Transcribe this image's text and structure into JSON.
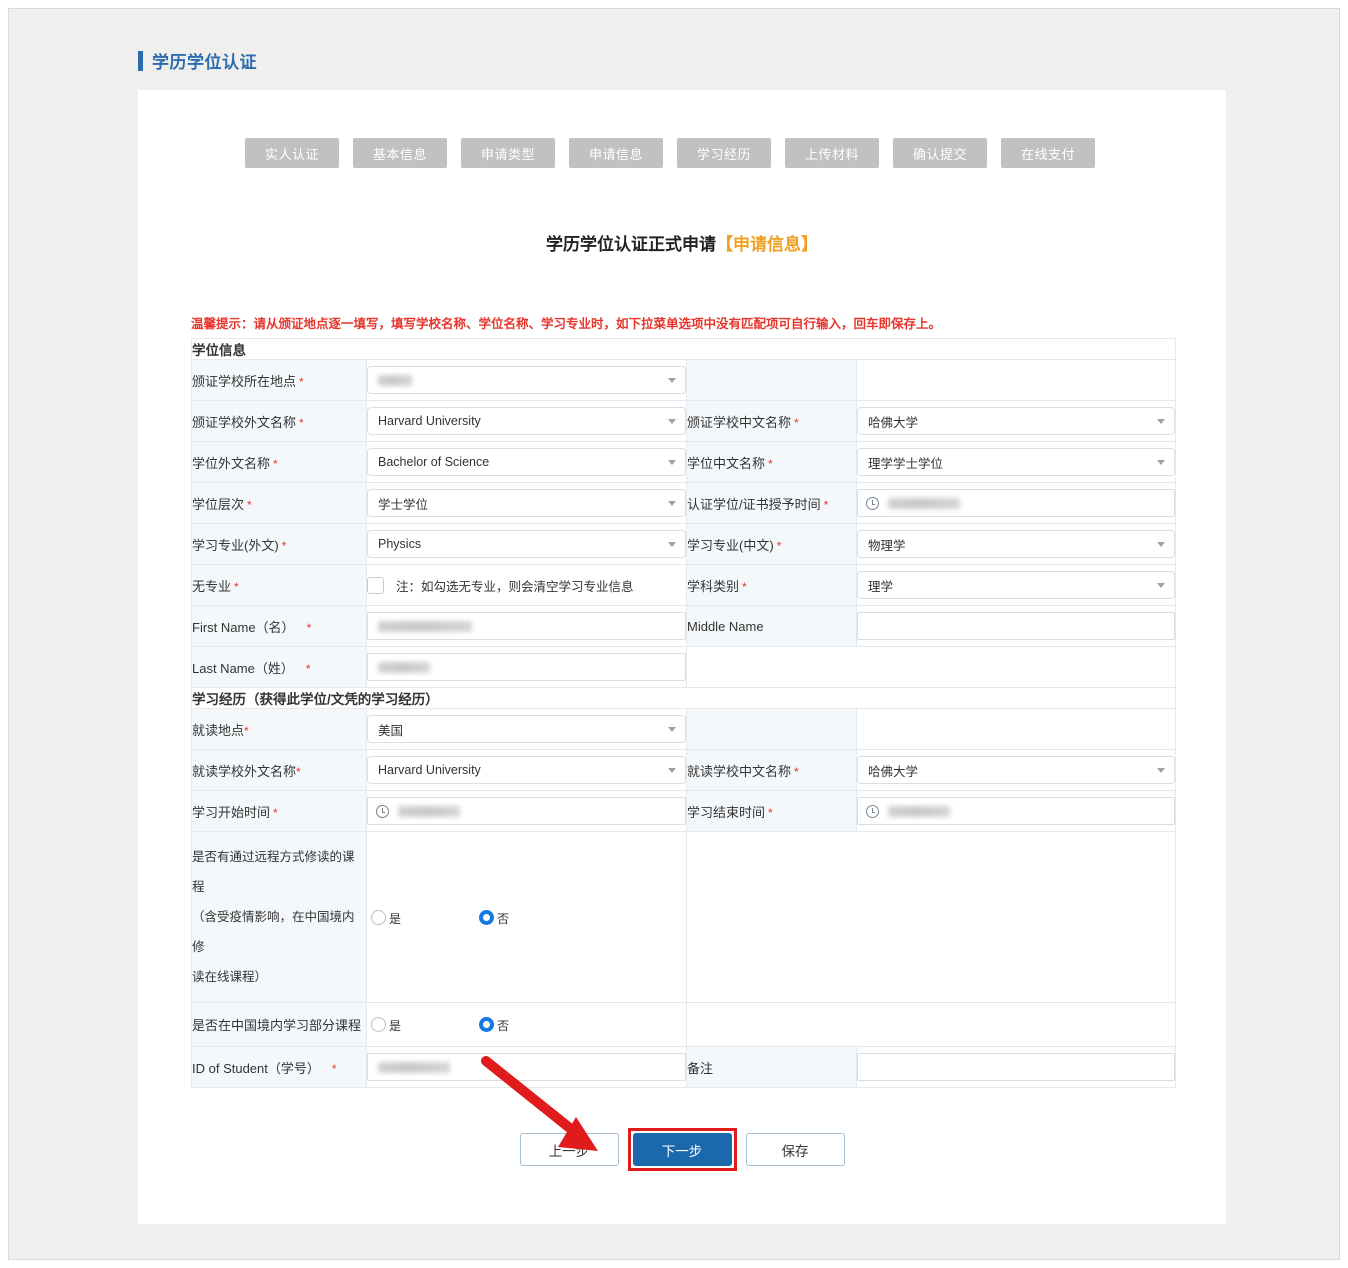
{
  "header": {
    "title": "学历学位认证"
  },
  "steps": [
    {
      "label": "实人认证"
    },
    {
      "label": "基本信息"
    },
    {
      "label": "申请类型"
    },
    {
      "label": "申请信息"
    },
    {
      "label": "学习经历"
    },
    {
      "label": "上传材料"
    },
    {
      "label": "确认提交"
    },
    {
      "label": "在线支付"
    }
  ],
  "form": {
    "title_main": "学历学位认证正式申请",
    "title_highlight": "【申请信息】",
    "notice": "温馨提示：请从颁证地点逐一填写，填写学校名称、学位名称、学习专业时，如下拉菜单选项中没有匹配项可自行输入，回车即保存上。"
  },
  "degree_section": {
    "heading": "学位信息",
    "rows": {
      "issue_location_label": "颁证学校所在地点",
      "issue_location_value": "",
      "school_foreign_label": "颁证学校外文名称",
      "school_foreign_value": "Harvard University",
      "school_chinese_label": "颁证学校中文名称",
      "school_chinese_value": "哈佛大学",
      "degree_foreign_label": "学位外文名称",
      "degree_foreign_value": "Bachelor of Science",
      "degree_chinese_label": "学位中文名称",
      "degree_chinese_value": "理学学士学位",
      "degree_level_label": "学位层次",
      "degree_level_value": "学士学位",
      "award_date_label": "认证学位/证书授予时间",
      "award_date_value": "",
      "major_foreign_label": "学习专业(外文)",
      "major_foreign_value": "Physics",
      "major_chinese_label": "学习专业(中文)",
      "major_chinese_value": "物理学",
      "no_major_label": "无专业",
      "no_major_note": "注：如勾选无专业，则会清空学习专业信息",
      "no_major_checked": false,
      "subject_category_label": "学科类别",
      "subject_category_value": "理学",
      "first_name_label": "First Name（名）",
      "first_name_value": "",
      "middle_name_label": "Middle Name",
      "middle_name_value": "",
      "last_name_label": "Last Name（姓）",
      "last_name_value": ""
    }
  },
  "study_section": {
    "heading": "学习经历（获得此学位/文凭的学习经历）",
    "rows": {
      "study_location_label": "就读地点",
      "study_location_value": "美国",
      "study_school_foreign_label": "就读学校外文名称",
      "study_school_foreign_value": "Harvard University",
      "study_school_chinese_label": "就读学校中文名称",
      "study_school_chinese_value": "哈佛大学",
      "start_date_label": "学习开始时间",
      "start_date_value": "",
      "end_date_label": "学习结束时间",
      "end_date_value": "",
      "remote_label_line1": "是否有通过远程方式修读的课程",
      "remote_label_line2": "（含受疫情影响，在中国境内修",
      "remote_label_line3": "读在线课程）",
      "remote_yes": "是",
      "remote_no": "否",
      "remote_selected": "否",
      "domestic_label": "是否在中国境内学习部分课程",
      "domestic_yes": "是",
      "domestic_no": "否",
      "domestic_selected": "否",
      "student_id_label": "ID of Student（学号）",
      "student_id_value": "",
      "remark_label": "备注",
      "remark_value": ""
    }
  },
  "buttons": {
    "prev": "上一步",
    "next": "下一步",
    "save": "保存"
  },
  "colors": {
    "accent_blue": "#2c6cad",
    "primary_button": "#1b68ad",
    "highlight_orange": "#f0a020",
    "notice_red": "#e8362c",
    "annotation_red": "#e11b1b",
    "step_grey": "#c3c1bf",
    "radio_blue": "#1478e6"
  }
}
